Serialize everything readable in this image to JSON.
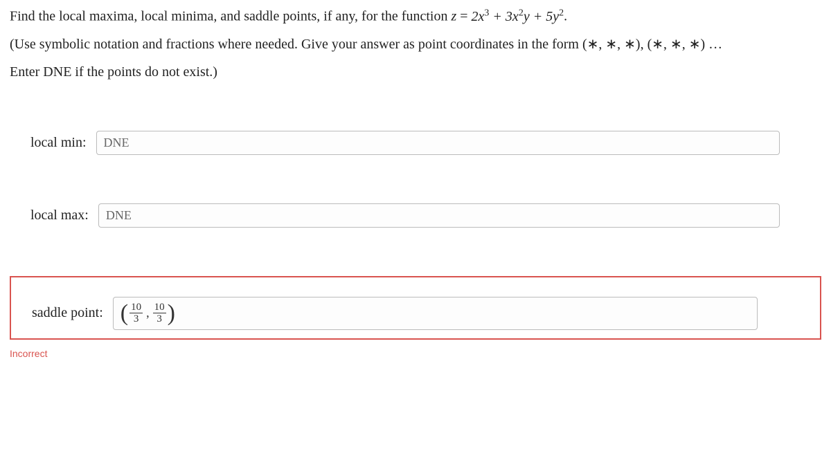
{
  "question": {
    "line1_prefix": "Find the local maxima, local minima, and saddle points, if any, for the function ",
    "equation_lhs": "z",
    "equation_eq": " = ",
    "equation_rhs": "2x³ + 3x²y + 5y²",
    "period": ".",
    "line2": "(Use symbolic notation and fractions where needed. Give your answer as point coordinates in the form (∗, ∗, ∗), (∗, ∗, ∗) …",
    "line3": "Enter DNE if the points do not exist.)"
  },
  "answers": {
    "local_min": {
      "label": "local min:",
      "value": "DNE"
    },
    "local_max": {
      "label": "local max:",
      "value": "DNE"
    },
    "saddle": {
      "label": "saddle point:",
      "frac1_num": "10",
      "frac1_den": "3",
      "frac2_num": "10",
      "frac2_den": "3"
    }
  },
  "feedback": {
    "incorrect": "Incorrect"
  }
}
